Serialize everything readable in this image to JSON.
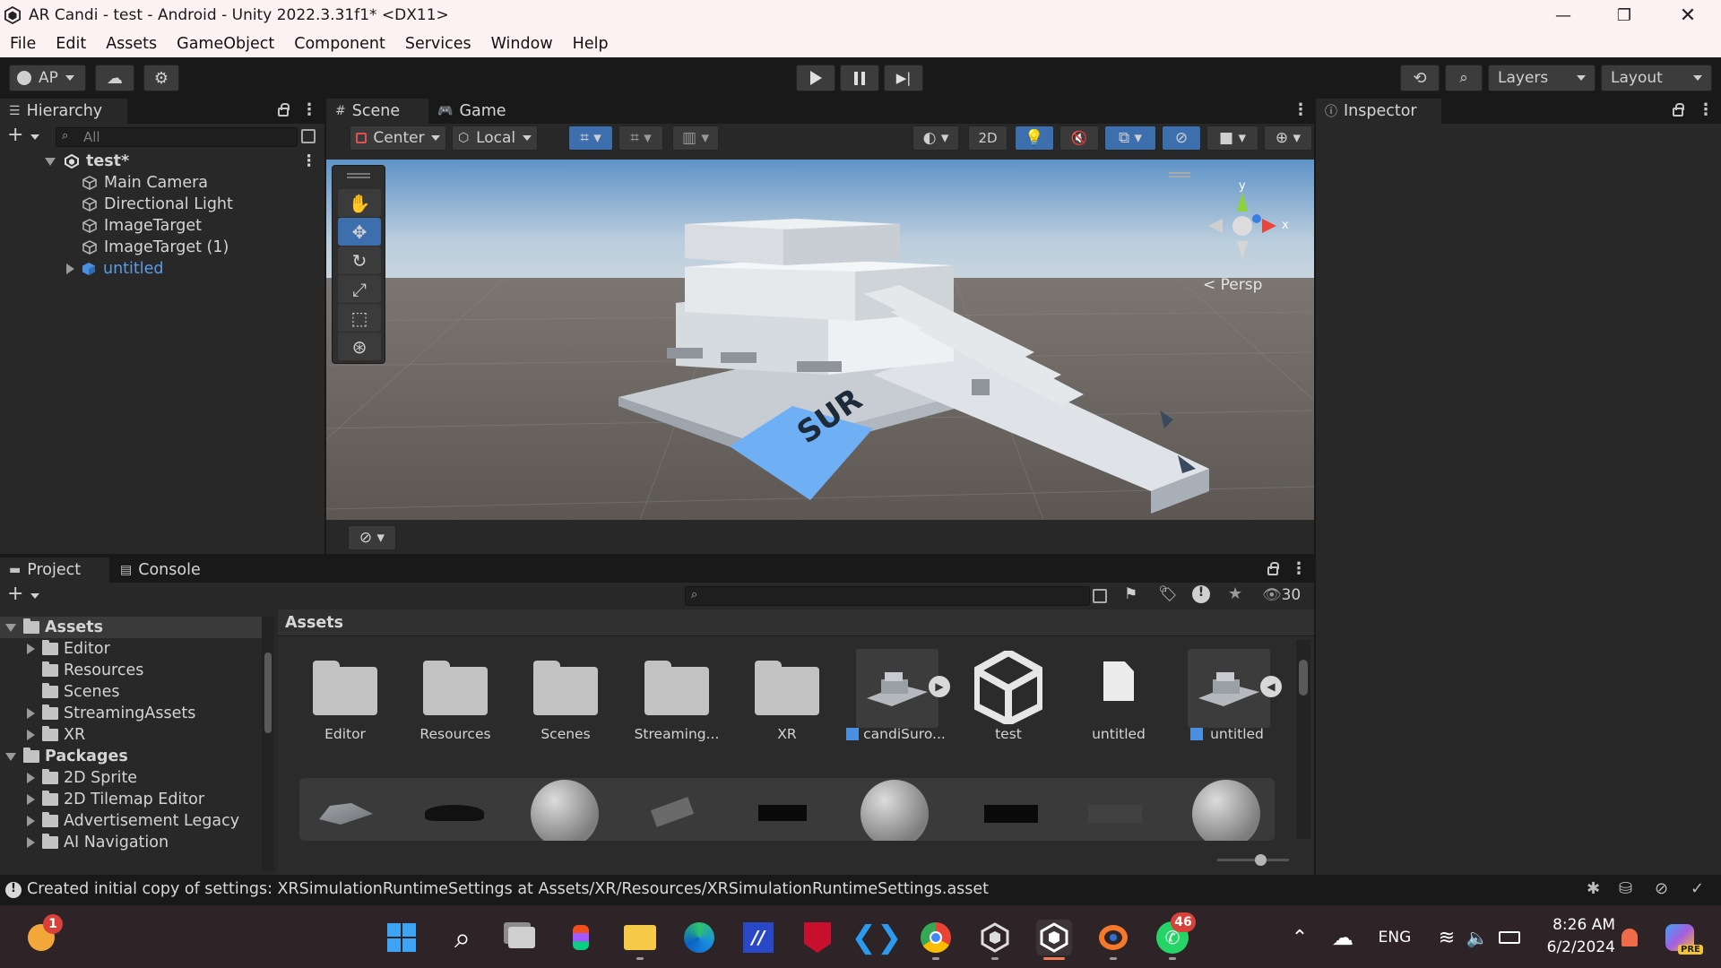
{
  "window": {
    "title": "AR Candi - test - Android - Unity 2022.3.31f1* <DX11>"
  },
  "menu": [
    "File",
    "Edit",
    "Assets",
    "GameObject",
    "Component",
    "Services",
    "Window",
    "Help"
  ],
  "toolbar": {
    "account_label": "AP",
    "layers_label": "Layers",
    "layout_label": "Layout"
  },
  "hierarchy": {
    "tab": "Hierarchy",
    "search_placeholder": "All",
    "scene_name": "test*",
    "items": [
      "Main Camera",
      "Directional Light",
      "ImageTarget",
      "ImageTarget (1)",
      "untitled"
    ]
  },
  "scene_view": {
    "tabs": [
      "Scene",
      "Game"
    ],
    "pivot_label": "Center",
    "space_label": "Local",
    "mode_2d": "2D",
    "persp_label": "Persp",
    "axis_y": "y",
    "axis_x": "x",
    "marker_text": "SUR"
  },
  "inspector": {
    "tab": "Inspector"
  },
  "project": {
    "tabs": [
      "Project",
      "Console"
    ],
    "hidden_count": "30",
    "breadcrumb": "Assets",
    "tree": [
      {
        "label": "Assets",
        "level": 0,
        "expanded": true,
        "bold": true
      },
      {
        "label": "Editor",
        "level": 1,
        "expandable": true
      },
      {
        "label": "Resources",
        "level": 1,
        "expandable": false
      },
      {
        "label": "Scenes",
        "level": 1,
        "expandable": false
      },
      {
        "label": "StreamingAssets",
        "level": 1,
        "expandable": true
      },
      {
        "label": "XR",
        "level": 1,
        "expandable": true
      },
      {
        "label": "Packages",
        "level": 0,
        "expanded": true,
        "bold": true
      },
      {
        "label": "2D Sprite",
        "level": 1,
        "expandable": true
      },
      {
        "label": "2D Tilemap Editor",
        "level": 1,
        "expandable": true
      },
      {
        "label": "Advertisement Legacy",
        "level": 1,
        "expandable": true
      },
      {
        "label": "AI Navigation",
        "level": 1,
        "expandable": true
      }
    ],
    "assets": [
      {
        "label": "Editor",
        "kind": "folder"
      },
      {
        "label": "Resources",
        "kind": "folder"
      },
      {
        "label": "Scenes",
        "kind": "folder"
      },
      {
        "label": "Streaming...",
        "kind": "folder"
      },
      {
        "label": "XR",
        "kind": "folder"
      },
      {
        "label": "candiSuro...",
        "kind": "model"
      },
      {
        "label": "test",
        "kind": "unity"
      },
      {
        "label": "untitled",
        "kind": "file"
      },
      {
        "label": "untitled",
        "kind": "model"
      }
    ]
  },
  "status": {
    "message": "Created initial copy of settings: XRSimulationRuntimeSettings at Assets/XR/Resources/XRSimulationRuntimeSettings.asset"
  },
  "taskbar": {
    "weather_badge": "1",
    "whatsapp_badge": "46",
    "language": "ENG",
    "time": "8:26 AM",
    "date": "6/2/2024",
    "copilot_badge": "PRE"
  },
  "colors": {
    "unity_dark": "#191919",
    "panel": "#282828",
    "accent_blue": "#3d7fcf",
    "link_blue": "#5b9be8"
  }
}
